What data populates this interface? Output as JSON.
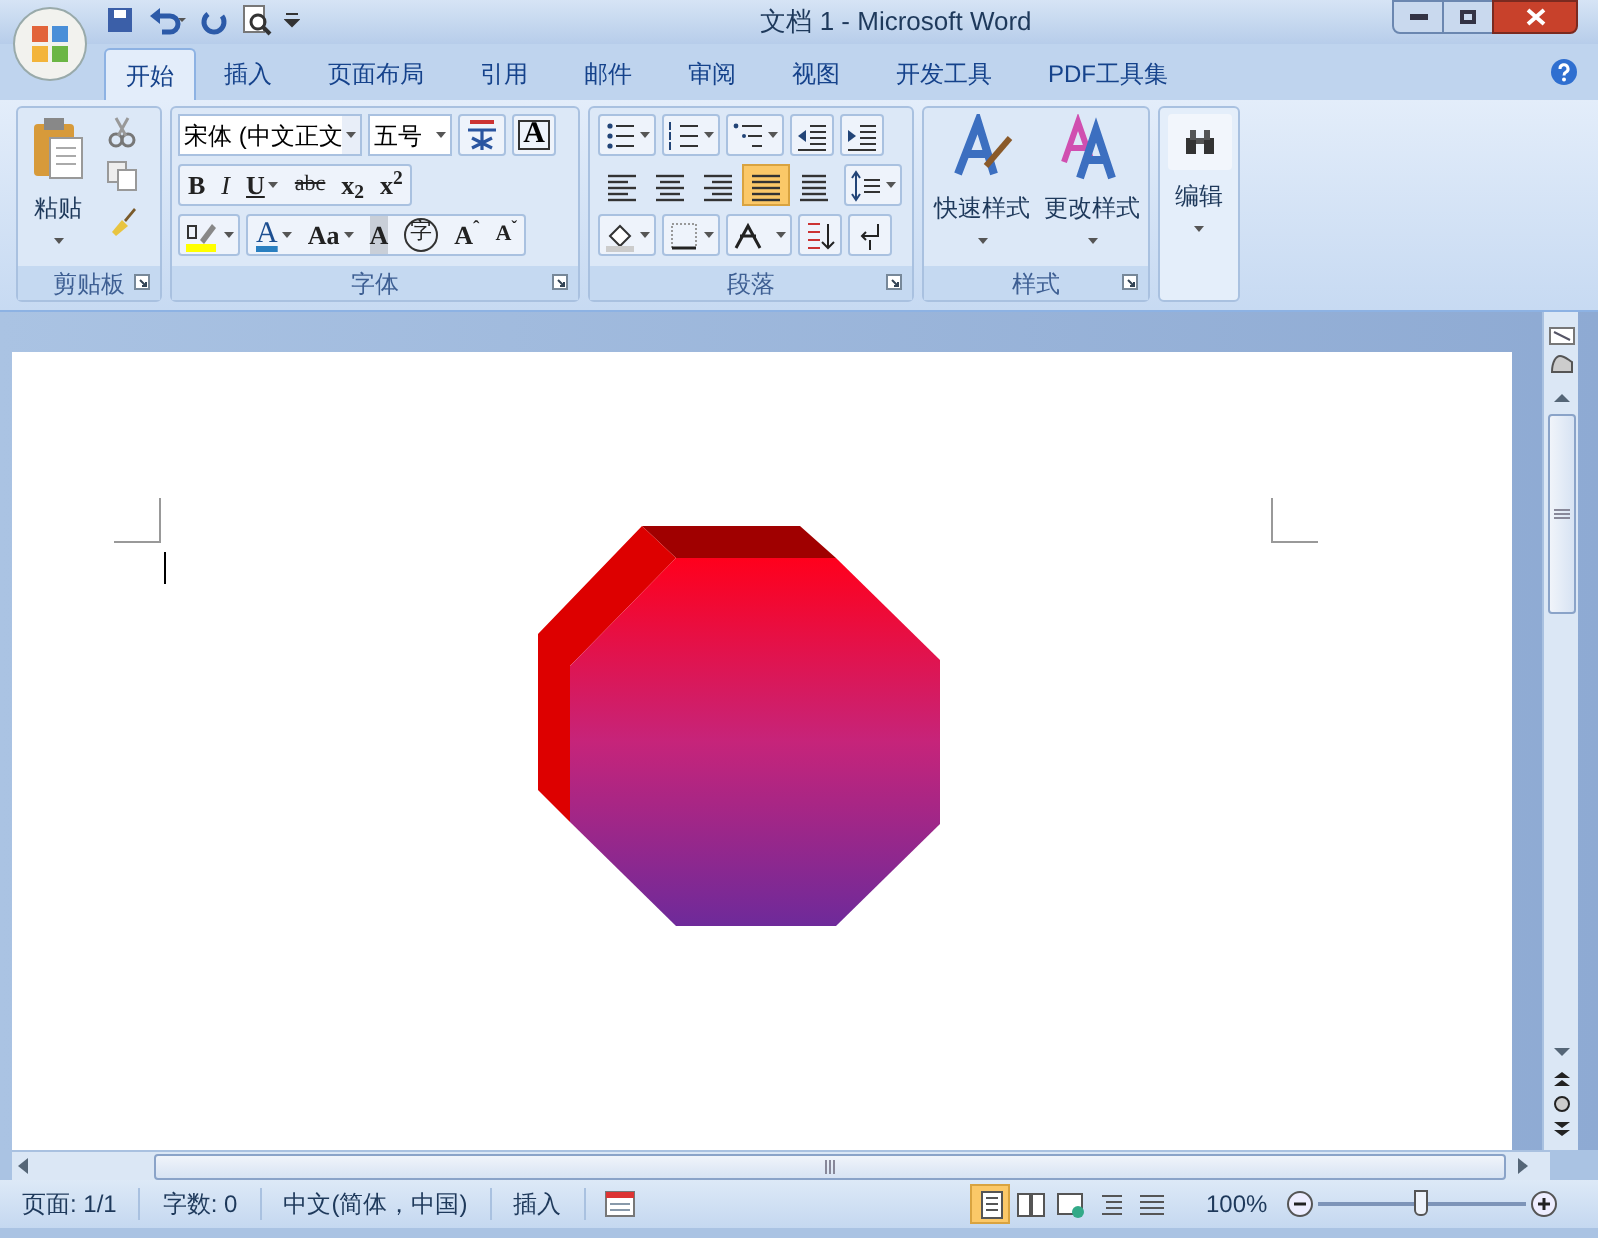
{
  "window": {
    "title": "文档 1 - Microsoft Word"
  },
  "tabs": [
    {
      "label": "开始",
      "selected": true
    },
    {
      "label": "插入",
      "selected": false
    },
    {
      "label": "页面布局",
      "selected": false
    },
    {
      "label": "引用",
      "selected": false
    },
    {
      "label": "邮件",
      "selected": false
    },
    {
      "label": "审阅",
      "selected": false
    },
    {
      "label": "视图",
      "selected": false
    },
    {
      "label": "开发工具",
      "selected": false
    },
    {
      "label": "PDF工具集",
      "selected": false
    }
  ],
  "clipboard": {
    "paste": "粘贴",
    "label": "剪贴板"
  },
  "font": {
    "name": "宋体 (中文正文",
    "size": "五号",
    "label": "字体",
    "rows": [
      [
        {
          "text": "B",
          "kind": "bold"
        },
        {
          "text": "I",
          "kind": "italic"
        },
        {
          "text": "U",
          "kind": "underline",
          "menu": true
        },
        {
          "text": "abc",
          "kind": "strike"
        },
        {
          "text": "x$_{2}$",
          "kind": "plain"
        },
        {
          "text": "x$^{2}$",
          "kind": "plain"
        }
      ],
      [
        {
          "text": "A",
          "kind": "color",
          "menu": true
        },
        {
          "text": "Aa",
          "kind": "plain",
          "menu": true
        },
        {
          "text": "A",
          "kind": "shade"
        },
        {
          "text": "字",
          "kind": "circle"
        },
        {
          "text": "A$^{ˆ}$",
          "kind": "plain"
        },
        {
          "text": "A$^{ˇ}$",
          "kind": "small"
        }
      ]
    ],
    "border_char": "A"
  },
  "paragraph": {
    "label": "段落",
    "buttons": [
      {
        "kind": "left",
        "selected": false
      },
      {
        "kind": "center",
        "selected": false
      },
      {
        "kind": "right",
        "selected": false
      },
      {
        "kind": "justify",
        "selected": true
      },
      {
        "kind": "distributed",
        "selected": false
      }
    ]
  },
  "styles": {
    "label": "样式",
    "items": [
      "快速样式",
      "更改样式"
    ]
  },
  "editing": {
    "label": "编辑"
  },
  "status_bar": {
    "items": [
      "页面: 1/1",
      "字数: 0",
      "中文(简体，中国)",
      "插入"
    ],
    "views": [
      {
        "selected": true
      },
      {
        "selected": false
      },
      {
        "selected": false
      },
      {
        "selected": false
      },
      {
        "selected": false
      }
    ],
    "zoom": "100%",
    "level": 0.5
  }
}
